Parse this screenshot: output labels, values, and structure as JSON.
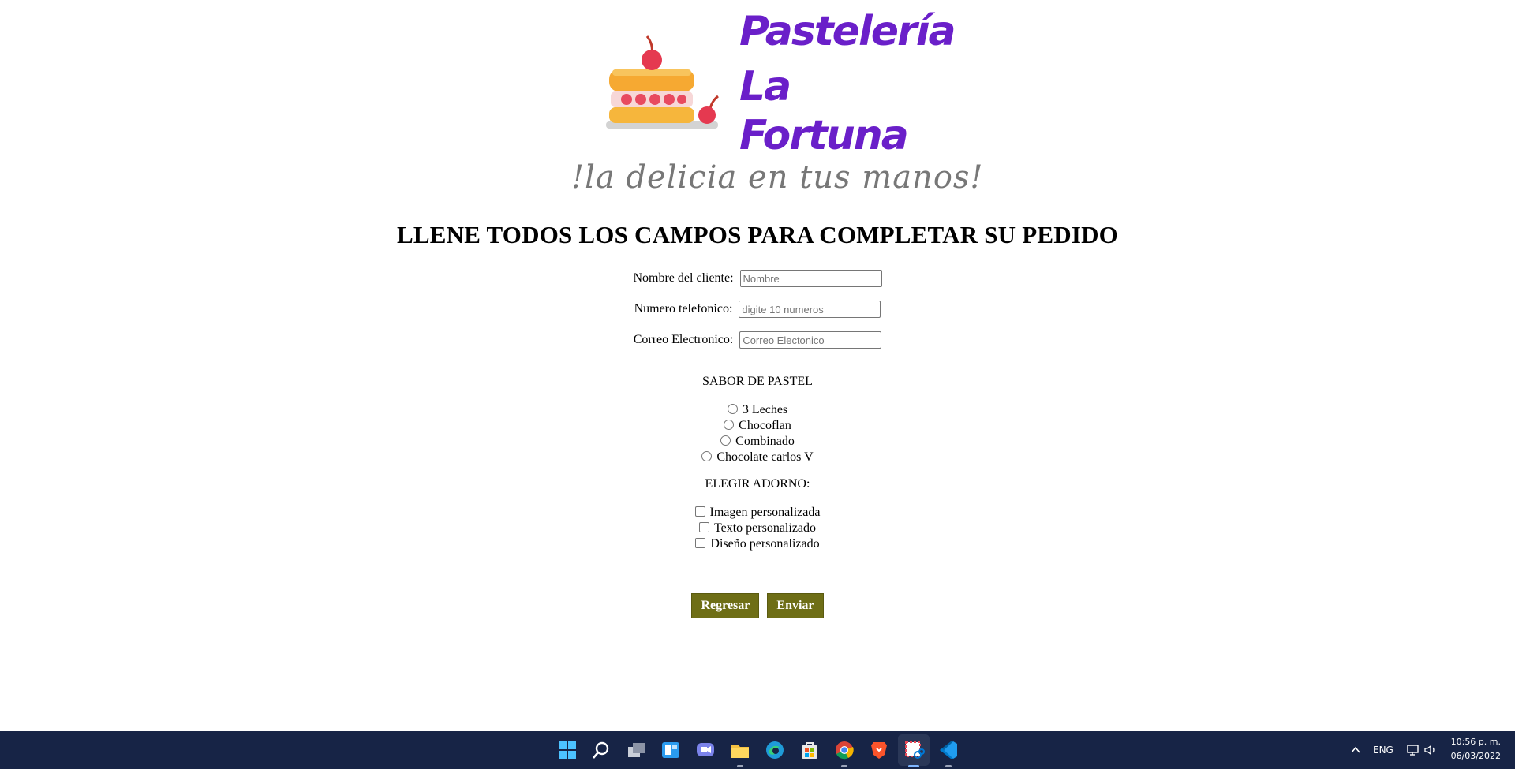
{
  "brand": {
    "name_line1": "Pastelería",
    "name_line2": "La",
    "name_line3": "Fortuna",
    "tagline": "!la delicia en tus manos!",
    "title_color": "#6a1fc9"
  },
  "heading": "LLENE TODOS LOS CAMPOS PARA COMPLETAR SU PEDIDO",
  "form": {
    "name": {
      "label": "Nombre del cliente:",
      "placeholder": "Nombre",
      "value": ""
    },
    "phone": {
      "label": "Numero telefonico:",
      "placeholder": "digite 10 numeros",
      "value": ""
    },
    "email": {
      "label": "Correo Electronico:",
      "placeholder": "Correo Electonico",
      "value": ""
    },
    "flavor_title": "SABOR DE PASTEL",
    "flavors": [
      "3 Leches",
      "Chocoflan",
      "Combinado",
      "Chocolate carlos V"
    ],
    "decor_title": "ELEGIR ADORNO:",
    "decor": [
      "Imagen personalizada",
      "Texto personalizado",
      "Diseño personalizado"
    ],
    "back_label": "Regresar",
    "send_label": "Enviar",
    "button_color": "#6e6e16"
  },
  "taskbar": {
    "icons": [
      "windows-start-icon",
      "search-icon",
      "task-view-icon",
      "widgets-icon",
      "teams-chat-icon",
      "file-explorer-icon",
      "edge-icon",
      "store-icon",
      "chrome-icon",
      "brave-icon",
      "snipping-tool-icon",
      "vscode-icon"
    ],
    "language": "ENG",
    "time": "10:56 p. m.",
    "date": "06/03/2022"
  }
}
